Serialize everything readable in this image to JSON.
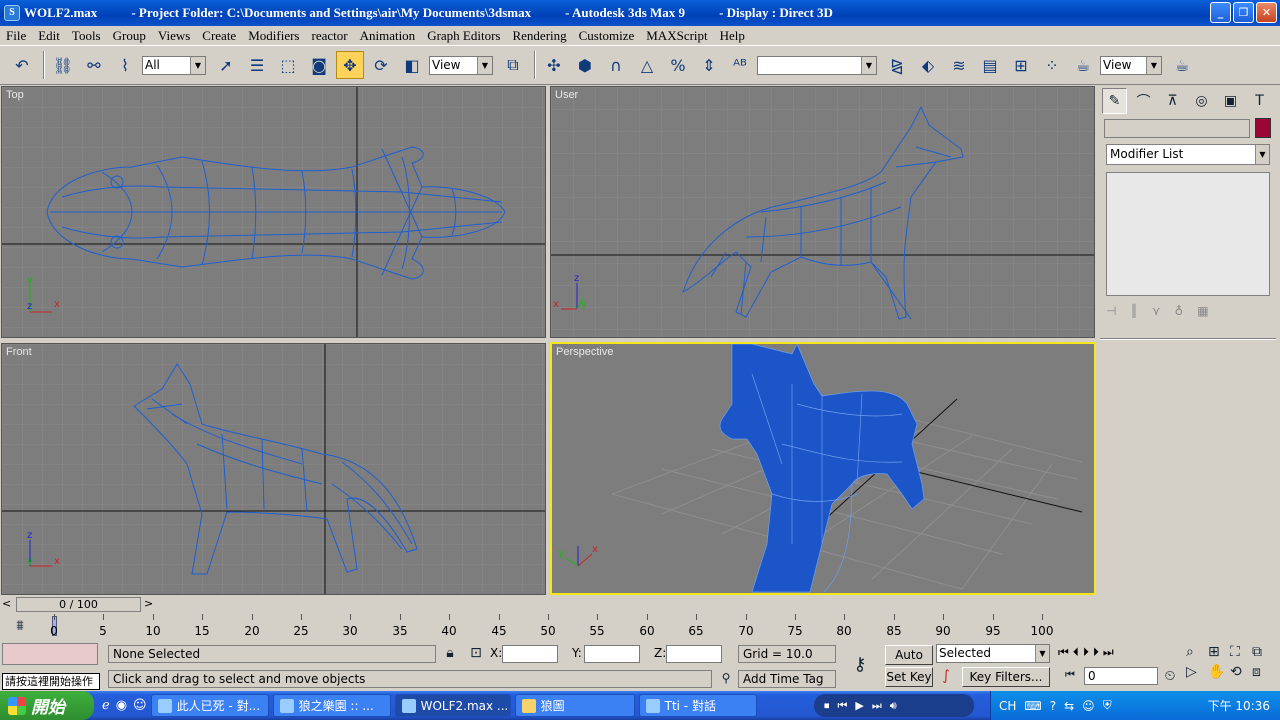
{
  "window": {
    "filename": "WOLF2.max",
    "project": "- Project Folder: C:\\Documents and Settings\\air\\My Documents\\3dsmax",
    "app": "- Autodesk 3ds Max 9",
    "display": "- Display : Direct 3D",
    "buttons": [
      "_",
      "❐",
      "✕"
    ]
  },
  "menu": [
    "File",
    "Edit",
    "Tools",
    "Group",
    "Views",
    "Create",
    "Modifiers",
    "reactor",
    "Animation",
    "Graph Editors",
    "Rendering",
    "Customize",
    "MAXScript",
    "Help"
  ],
  "toolbar": {
    "selection_filter": "All",
    "ref_coord": "View",
    "named_sel": "",
    "render_view": "View"
  },
  "viewports": {
    "top": "Top",
    "user": "User",
    "front": "Front",
    "perspective": "Perspective"
  },
  "command_panel": {
    "modifier_list": "Modifier List",
    "object_color": "#9a0636"
  },
  "timeline": {
    "slider": "0 / 100",
    "ticks": [
      "0",
      "5",
      "10",
      "15",
      "20",
      "25",
      "30",
      "35",
      "40",
      "45",
      "50",
      "55",
      "60",
      "65",
      "70",
      "75",
      "80",
      "85",
      "90",
      "95",
      "100"
    ]
  },
  "status": {
    "selection": "None Selected",
    "prompt": "Click and drag to select and move objects",
    "hint": "請按這裡開始操作",
    "x_label": "X:",
    "y_label": "Y:",
    "z_label": "Z:",
    "grid": "Grid = 10.0",
    "add_time_tag": "Add Time Tag",
    "auto_key": "Auto Key",
    "set_key": "Set Key",
    "key_mode": "Selected",
    "key_filters": "Key Filters...",
    "frame": "0"
  },
  "taskbar": {
    "start": "開始",
    "tasks": [
      "此人已死 - 對...",
      "狼之樂園 :: ...",
      "WOLF2.max  ...",
      "狼圖",
      "Tti - 對話"
    ],
    "lang": "CH",
    "clock": "下午 10:36"
  }
}
